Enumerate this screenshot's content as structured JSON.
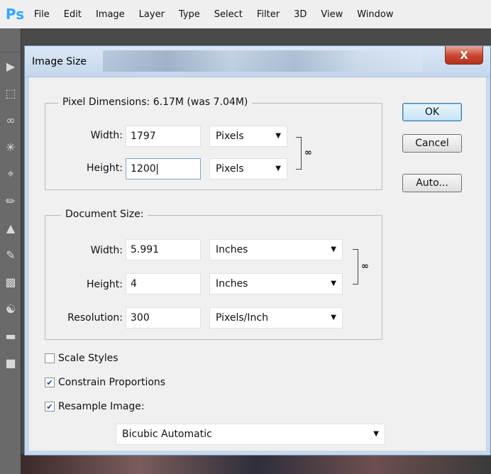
{
  "app": {
    "logo": "Ps",
    "menu": [
      "File",
      "Edit",
      "Image",
      "Layer",
      "Type",
      "Select",
      "Filter",
      "3D",
      "View",
      "Window"
    ]
  },
  "dialog": {
    "title": "Image Size",
    "close_label": "X",
    "pixel_dimensions": {
      "legend": "Pixel Dimensions:  6.17M (was 7.04M)",
      "width_label": "Width:",
      "width_value": "1797",
      "width_unit": "Pixels",
      "height_label": "Height:",
      "height_value": "1200",
      "height_unit": "Pixels"
    },
    "document_size": {
      "legend": "Document Size:",
      "width_label": "Width:",
      "width_value": "5.991",
      "width_unit": "Inches",
      "height_label": "Height:",
      "height_value": "4",
      "height_unit": "Inches",
      "resolution_label": "Resolution:",
      "resolution_value": "300",
      "resolution_unit": "Pixels/Inch"
    },
    "buttons": {
      "ok": "OK",
      "cancel": "Cancel",
      "auto": "Auto..."
    },
    "options": {
      "scale_styles": {
        "label": "Scale Styles",
        "checked": false
      },
      "constrain_proportions": {
        "label": "Constrain Proportions",
        "checked": true
      },
      "resample_image": {
        "label": "Resample Image:",
        "checked": true
      },
      "resample_method": "Bicubic Automatic"
    }
  },
  "icons": {
    "chain": "chain-link-icon",
    "dropdown": "chevron-down-icon",
    "close": "close-icon"
  }
}
